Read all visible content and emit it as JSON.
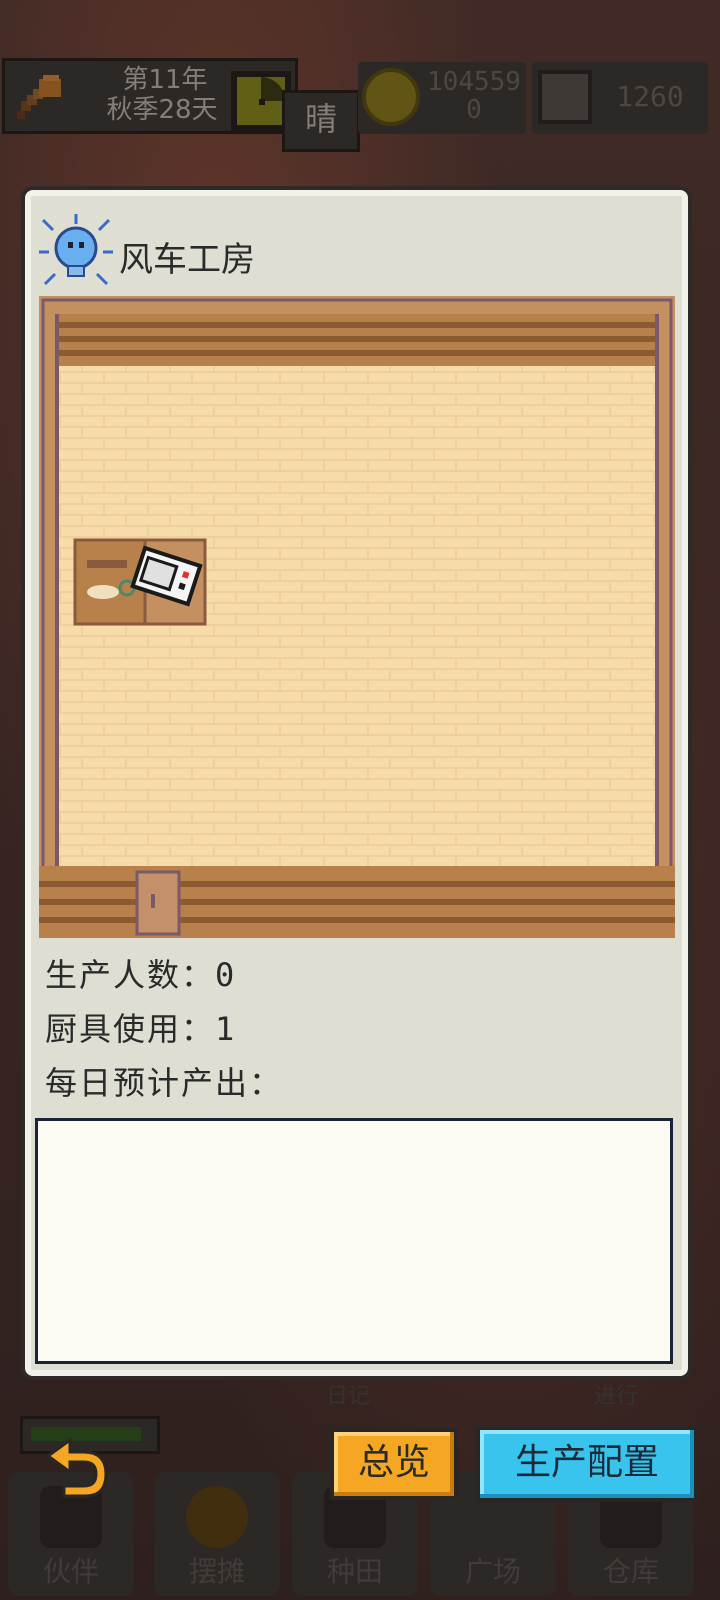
{
  "hud": {
    "year": "第11年",
    "season_day": "秋季28天",
    "weather": "晴",
    "coins_line1": "104559",
    "coins_line2": "0",
    "gems": "1260"
  },
  "modal": {
    "title": "风车工房",
    "stats": {
      "workers": "生产人数：0",
      "cookware": "厨具使用：1",
      "daily_output": "每日预计产出："
    },
    "output_items": []
  },
  "buttons": {
    "overview": "总览",
    "production_config": "生产配置"
  },
  "background_peek": {
    "diary": "日记",
    "progress": "进行"
  },
  "nav": {
    "items": [
      {
        "label": "伙伴",
        "icon": "partners-icon"
      },
      {
        "label": "摆摊",
        "icon": "stall-icon"
      },
      {
        "label": "种田",
        "icon": "farming-icon"
      },
      {
        "label": "广场",
        "icon": "plaza-icon"
      },
      {
        "label": "仓库",
        "icon": "warehouse-icon"
      }
    ]
  },
  "colors": {
    "overview_button": "#f5a623",
    "config_button": "#38c4ec",
    "modal_bg": "#dedfd2",
    "floor": "#f0d09a"
  }
}
